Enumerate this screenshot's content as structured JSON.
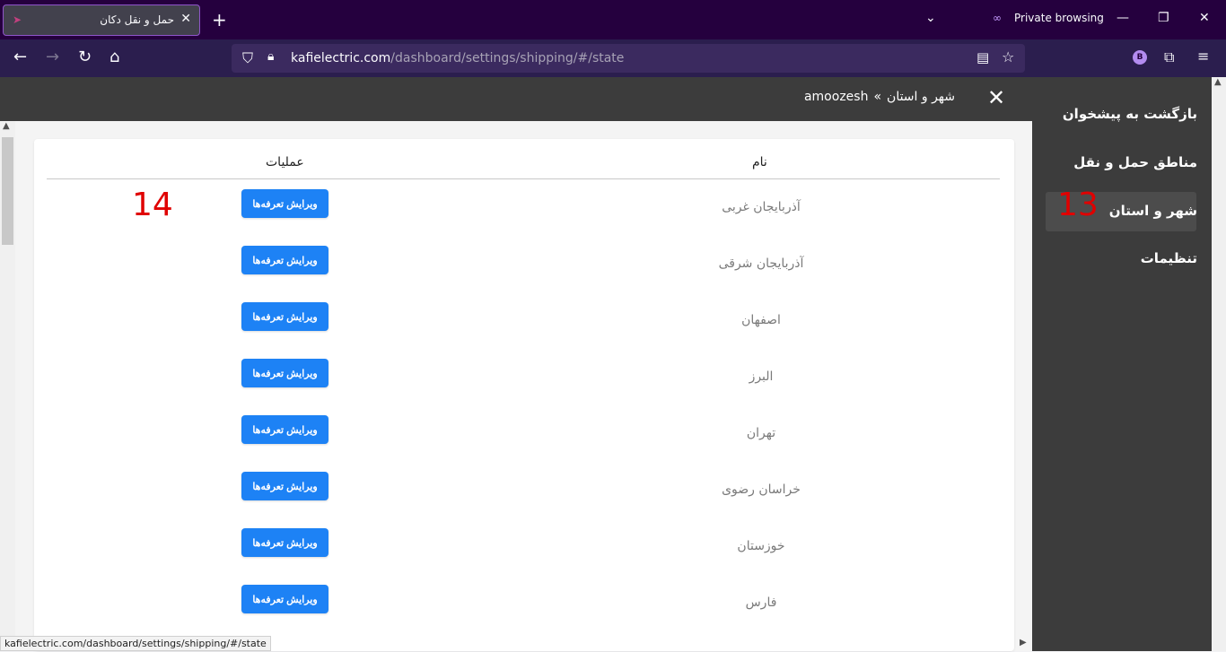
{
  "browser": {
    "tab_title": "حمل و نقل دکان",
    "tab_close": "✕",
    "new_tab": "+",
    "list_tabs": "⌄",
    "private_label": "Private browsing",
    "window_minimize": "—",
    "window_restore": "❐",
    "window_close": "✕",
    "url_domain": "kafielectric.com",
    "url_path": "/dashboard/settings/shipping/#/state",
    "profile_letter": "B",
    "status_url": "kafielectric.com/dashboard/settings/shipping/#/state"
  },
  "header": {
    "breadcrumb_root": "amoozesh",
    "breadcrumb_sep": "»",
    "breadcrumb_current": "شهر و استان"
  },
  "sidebar": {
    "items": [
      {
        "label": "بازگشت به پیشخوان"
      },
      {
        "label": "مناطق حمل و نقل"
      },
      {
        "label": "شهر و استان"
      },
      {
        "label": "تنظیمات"
      }
    ]
  },
  "table": {
    "col_name": "نام",
    "col_actions": "عملیات",
    "button_label": "ویرایش تعرفه‌ها",
    "rows": [
      {
        "name": "آذربایجان غربی"
      },
      {
        "name": "آذربایجان شرقی"
      },
      {
        "name": "اصفهان"
      },
      {
        "name": "البرز"
      },
      {
        "name": "تهران"
      },
      {
        "name": "خراسان رضوی"
      },
      {
        "name": "خوزستان"
      },
      {
        "name": "فارس"
      }
    ]
  },
  "annotations": {
    "marker_13": "13",
    "marker_14": "14"
  },
  "colors": {
    "accent_button": "#1d82f5",
    "annotation_red": "#e00000",
    "sidebar_bg": "#3c3c3c"
  }
}
